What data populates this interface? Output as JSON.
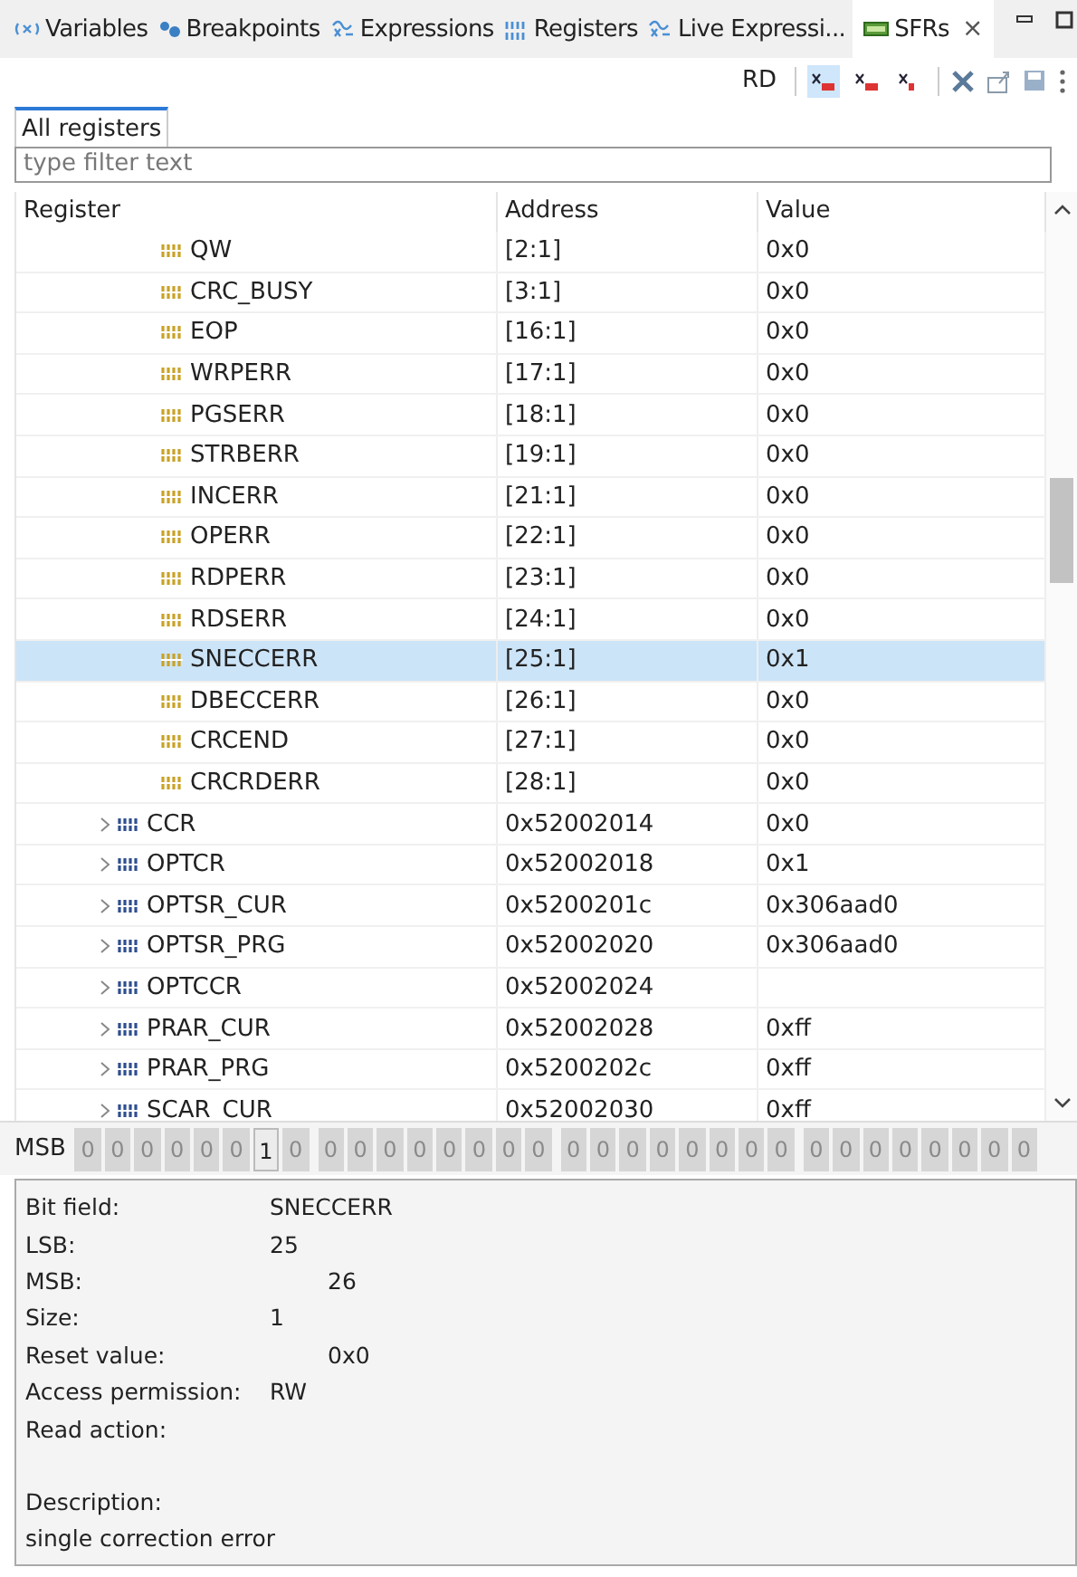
{
  "view_tabs": [
    {
      "label": "Variables",
      "kind": "variables",
      "selected": false
    },
    {
      "label": "Breakpoints",
      "kind": "breakpoints",
      "selected": false
    },
    {
      "label": "Expressions",
      "kind": "expressions",
      "selected": false
    },
    {
      "label": "Registers",
      "kind": "registers",
      "selected": false
    },
    {
      "label": "Live Expressi...",
      "kind": "expressions",
      "selected": false
    },
    {
      "label": "SFRs",
      "kind": "sfr",
      "selected": true,
      "close": "×"
    }
  ],
  "toolbar": {
    "mode": "RD",
    "buttons": [
      {
        "kind": "hex",
        "selected": true
      },
      {
        "kind": "dec",
        "selected": false
      },
      {
        "kind": "bin",
        "selected": false
      }
    ]
  },
  "subtabs": [
    {
      "label": "All registers",
      "selected": true
    }
  ],
  "filter": {
    "placeholder": "type filter text"
  },
  "table": {
    "columns": [
      "Register",
      "Address",
      "Value"
    ],
    "rows": [
      {
        "kind": "field",
        "name": "QW",
        "address": "[2:1]",
        "value": "0x0",
        "selected": false
      },
      {
        "kind": "field",
        "name": "CRC_BUSY",
        "address": "[3:1]",
        "value": "0x0",
        "selected": false
      },
      {
        "kind": "field",
        "name": "EOP",
        "address": "[16:1]",
        "value": "0x0",
        "selected": false
      },
      {
        "kind": "field",
        "name": "WRPERR",
        "address": "[17:1]",
        "value": "0x0",
        "selected": false
      },
      {
        "kind": "field",
        "name": "PGSERR",
        "address": "[18:1]",
        "value": "0x0",
        "selected": false
      },
      {
        "kind": "field",
        "name": "STRBERR",
        "address": "[19:1]",
        "value": "0x0",
        "selected": false
      },
      {
        "kind": "field",
        "name": "INCERR",
        "address": "[21:1]",
        "value": "0x0",
        "selected": false
      },
      {
        "kind": "field",
        "name": "OPERR",
        "address": "[22:1]",
        "value": "0x0",
        "selected": false
      },
      {
        "kind": "field",
        "name": "RDPERR",
        "address": "[23:1]",
        "value": "0x0",
        "selected": false
      },
      {
        "kind": "field",
        "name": "RDSERR",
        "address": "[24:1]",
        "value": "0x0",
        "selected": false
      },
      {
        "kind": "field",
        "name": "SNECCERR",
        "address": "[25:1]",
        "value": "0x1",
        "selected": true
      },
      {
        "kind": "field",
        "name": "DBECCERR",
        "address": "[26:1]",
        "value": "0x0",
        "selected": false
      },
      {
        "kind": "field",
        "name": "CRCEND",
        "address": "[27:1]",
        "value": "0x0",
        "selected": false
      },
      {
        "kind": "field",
        "name": "CRCRDERR",
        "address": "[28:1]",
        "value": "0x0",
        "selected": false
      },
      {
        "kind": "register",
        "name": "CCR",
        "address": "0x52002014",
        "value": "0x0",
        "selected": false
      },
      {
        "kind": "register",
        "name": "OPTCR",
        "address": "0x52002018",
        "value": "0x1",
        "selected": false
      },
      {
        "kind": "register",
        "name": "OPTSR_CUR",
        "address": "0x5200201c",
        "value": "0x306aad0",
        "selected": false
      },
      {
        "kind": "register",
        "name": "OPTSR_PRG",
        "address": "0x52002020",
        "value": "0x306aad0",
        "selected": false
      },
      {
        "kind": "register",
        "name": "OPTCCR",
        "address": "0x52002024",
        "selected": false
      },
      {
        "kind": "register",
        "name": "PRAR_CUR",
        "address": "0x52002028",
        "value": "0xff",
        "selected": false
      },
      {
        "kind": "register",
        "name": "PRAR_PRG",
        "address": "0x5200202c",
        "value": "0xff",
        "selected": false
      },
      {
        "kind": "register",
        "name": "SCAR_CUR",
        "address": "0x52002030",
        "value": "0xff",
        "selected": false
      }
    ]
  },
  "bits": {
    "label": "MSB",
    "values": [
      {
        "value": "0",
        "selected": false
      },
      {
        "value": "0",
        "selected": false
      },
      {
        "value": "0",
        "selected": false
      },
      {
        "value": "0",
        "selected": false
      },
      {
        "value": "0",
        "selected": false
      },
      {
        "value": "0",
        "selected": false
      },
      {
        "value": "1",
        "selected": true
      },
      {
        "value": "0",
        "selected": false
      },
      {
        "value": "0",
        "selected": false
      },
      {
        "value": "0",
        "selected": false
      },
      {
        "value": "0",
        "selected": false
      },
      {
        "value": "0",
        "selected": false
      },
      {
        "value": "0",
        "selected": false
      },
      {
        "value": "0",
        "selected": false
      },
      {
        "value": "0",
        "selected": false
      },
      {
        "value": "0",
        "selected": false
      },
      {
        "value": "0",
        "selected": false
      },
      {
        "value": "0",
        "selected": false
      },
      {
        "value": "0",
        "selected": false
      },
      {
        "value": "0",
        "selected": false
      },
      {
        "value": "0",
        "selected": false
      },
      {
        "value": "0",
        "selected": false
      },
      {
        "value": "0",
        "selected": false
      },
      {
        "value": "0",
        "selected": false
      },
      {
        "value": "0",
        "selected": false
      },
      {
        "value": "0",
        "selected": false
      },
      {
        "value": "0",
        "selected": false
      },
      {
        "value": "0",
        "selected": false
      },
      {
        "value": "0",
        "selected": false
      },
      {
        "value": "0",
        "selected": false
      },
      {
        "value": "0",
        "selected": false
      },
      {
        "value": "0",
        "selected": false
      }
    ]
  },
  "details": [
    {
      "label": "Bit field:",
      "value": "SNECCERR",
      "indent": false
    },
    {
      "label": "LSB:",
      "value": "25",
      "indent": false
    },
    {
      "label": "MSB:",
      "value": "26",
      "indent": true
    },
    {
      "label": "Size:",
      "value": "1",
      "indent": false
    },
    {
      "label": "Reset value:",
      "value": "0x0",
      "indent": true
    },
    {
      "label": "Access permission:",
      "value": "RW",
      "indent": false
    },
    {
      "label": "Read action:"
    },
    {
      "label": "Description:",
      "gap": true
    },
    {
      "label": "single correction error"
    }
  ]
}
